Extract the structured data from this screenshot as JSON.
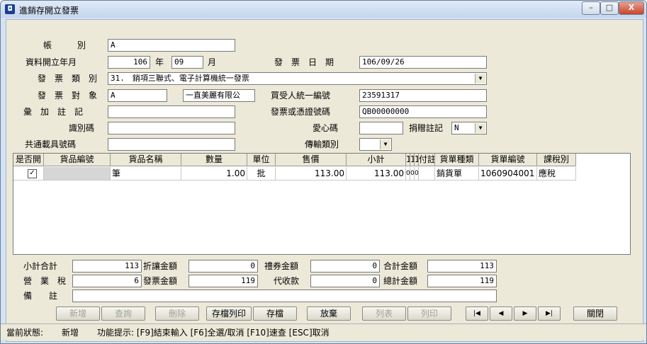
{
  "window": {
    "title": "進銷存開立發票",
    "minimize": "–",
    "maximize": "□",
    "close": "X",
    "app_icon": "app-icon"
  },
  "form": {
    "account_label": "帳　　　別",
    "account": "A",
    "period_label": "資料開立年月",
    "year": "106",
    "year_unit": "年",
    "month": "09",
    "month_unit": "月",
    "invoice_date_label": "發　票　日　期",
    "invoice_date": "106/09/26",
    "invoice_type_label": "發　票　類　別",
    "invoice_type": "31.　銷項三聯式、電子計算機統一發票",
    "invoice_target_label": "發　票　對　象",
    "invoice_target_code": "A",
    "invoice_target_name": "一直美麗有限公",
    "buyer_tax_id_label": "買受人統一編號",
    "buyer_tax_id": "23591317",
    "merge_note_label": "彙　加　註　記",
    "merge_note": "",
    "invoice_number_label": "發票或憑證號碼",
    "invoice_number": "QB00000000",
    "identifier_label": "識別碼",
    "identifier": "",
    "love_code_label": "愛心碼",
    "love_code": "",
    "donate_label": "捐贈註記",
    "donate": "N",
    "carrier_label": "共通載具號碼",
    "carrier": "",
    "transmit_type_label": "傳輸類別",
    "transmit_type": ""
  },
  "grid": {
    "headers": [
      "是否開",
      "貨品編號",
      "貨品名稱",
      "數量",
      "單位",
      "售價",
      "小計",
      "1",
      "1",
      "1",
      "付註",
      "貨單種類",
      "貨單編號",
      "課稅別"
    ],
    "row": {
      "checked": "✓",
      "product_code": "",
      "product_name": "筆",
      "qty": "1.00",
      "unit": "批",
      "price": "113.00",
      "subtotal": "113.00",
      "c1": "0",
      "c2": "0",
      "c3": "0",
      "note": "",
      "order_type": "銷貨單",
      "order_no": "1060904001",
      "tax_type": "應稅"
    }
  },
  "totals": {
    "subtotal_label": "小計合計",
    "subtotal": "113",
    "discount_label": "折讓金額",
    "discount": "0",
    "voucher_label": "禮券金額",
    "voucher": "0",
    "total_label": "合計金額",
    "total": "113",
    "tax_label": "營　業　稅",
    "tax": "6",
    "invoice_amount_label": "發票金額",
    "invoice_amount": "119",
    "collection_label": "代收款",
    "collection": "0",
    "grand_total_label": "總計金額",
    "grand_total": "119",
    "remark_label": "備　　註",
    "remark": ""
  },
  "buttons": {
    "add": "新增",
    "query": "查詢",
    "delete": "刪除",
    "save_print": "存檔列印",
    "save": "存檔",
    "abandon": "放棄",
    "list": "列表",
    "print": "列印",
    "first": "|◀",
    "prev": "◀",
    "next": "▶",
    "last": "▶|",
    "close": "關閉"
  },
  "status": {
    "state_label": "當前狀態:",
    "state": "新增",
    "hint": "功能提示: [F9]結束輸入 [F6]全選/取消 [F10]速查 [ESC]取消"
  }
}
